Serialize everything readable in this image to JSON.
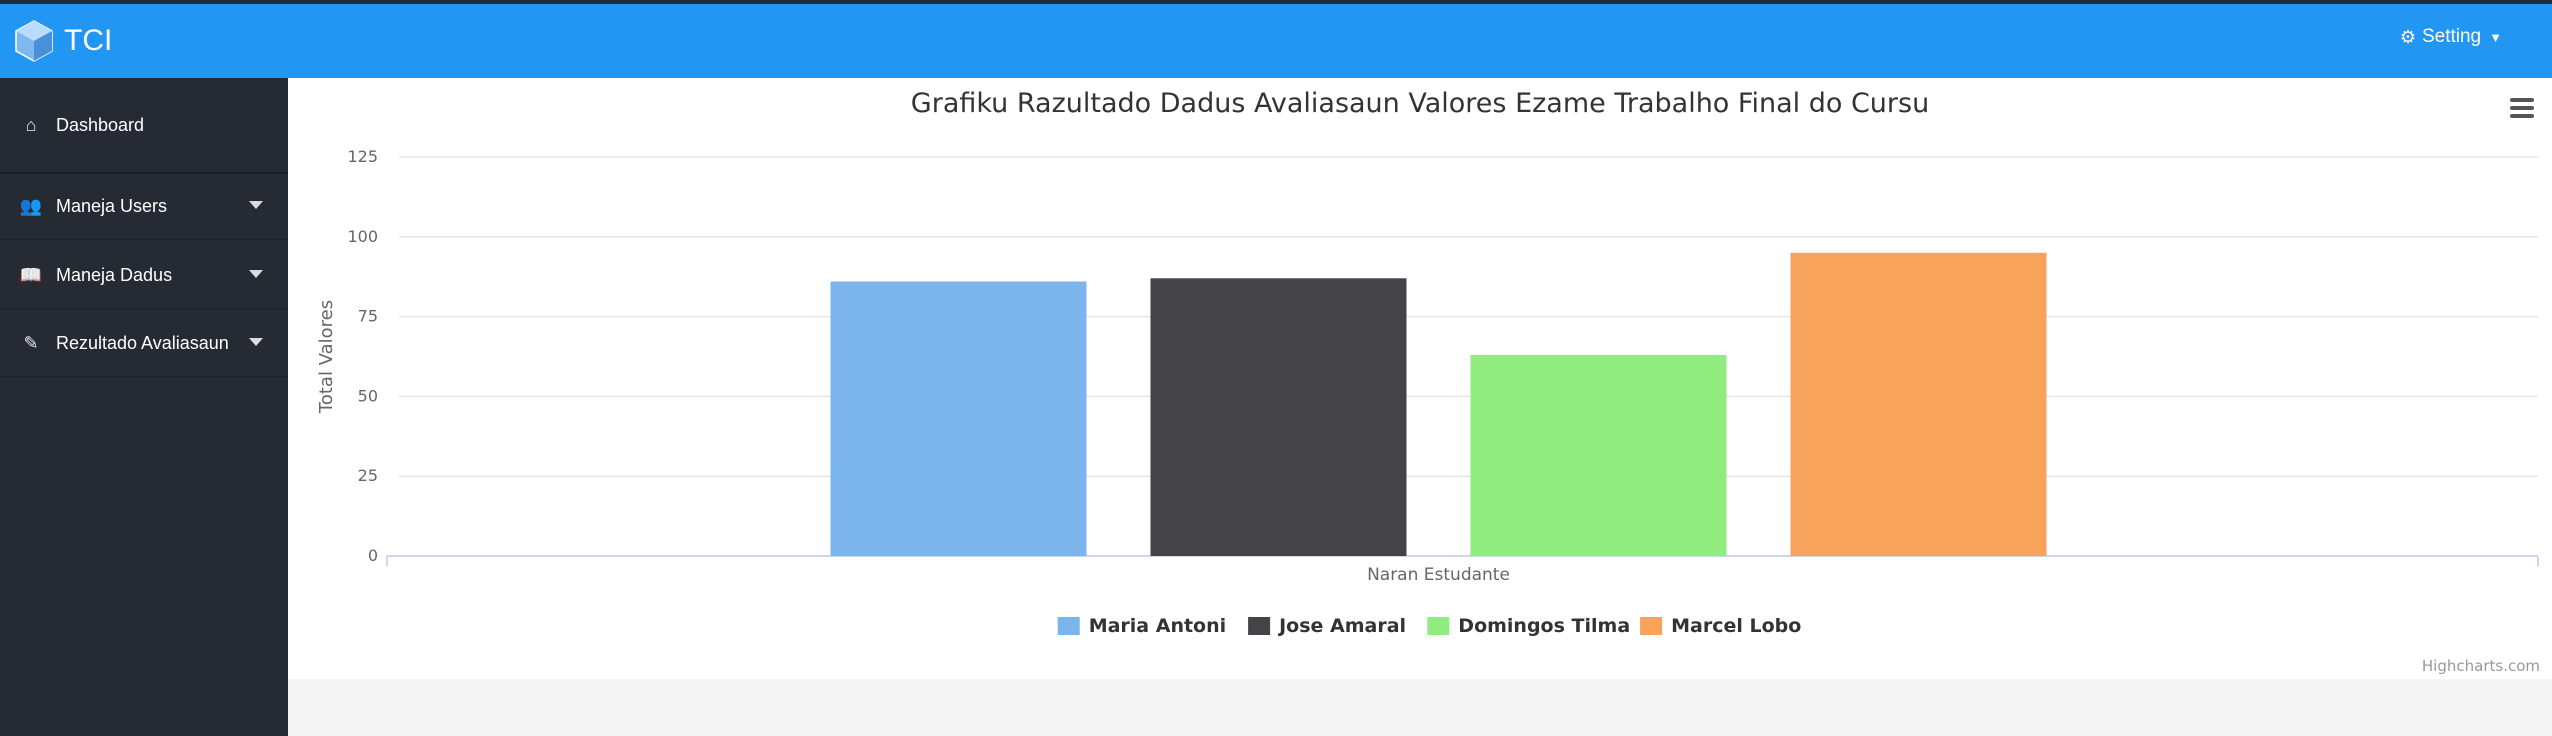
{
  "navbar": {
    "brand": "TCI",
    "setting_label": "Setting",
    "colors": {
      "navbar": "#2196f3",
      "sidebar": "#252a33"
    }
  },
  "sidebar": {
    "items": [
      {
        "label": "Dashboard",
        "icon": "home-icon"
      },
      {
        "label": "Maneja Users",
        "icon": "users-icon"
      },
      {
        "label": "Maneja Dadus",
        "icon": "book-icon"
      },
      {
        "label": "Rezultado Avaliasaun",
        "icon": "pencil-icon"
      }
    ]
  },
  "chart_data": {
    "type": "bar",
    "title": "Grafiku Razultado Dadus Avaliasaun Valores Ezame Trabalho Final do Cursu",
    "xlabel": "Naran Estudante",
    "ylabel": "Total Valores",
    "categories": [
      "Naran Estudante"
    ],
    "ylim": [
      0,
      125
    ],
    "yticks": [
      "0",
      "25",
      "50",
      "75",
      "100",
      "125"
    ],
    "grid": true,
    "legend_position": "bottom-center",
    "series": [
      {
        "name": "Maria Antoni",
        "values": [
          86
        ],
        "color": "#7cb5ec"
      },
      {
        "name": "Jose Amaral",
        "values": [
          87
        ],
        "color": "#434348"
      },
      {
        "name": "Domingos Tilma",
        "values": [
          63
        ],
        "color": "#90ed7d"
      },
      {
        "name": "Marcel Lobo",
        "values": [
          95
        ],
        "color": "#f7a35c"
      }
    ],
    "credits": "Highcharts.com"
  }
}
